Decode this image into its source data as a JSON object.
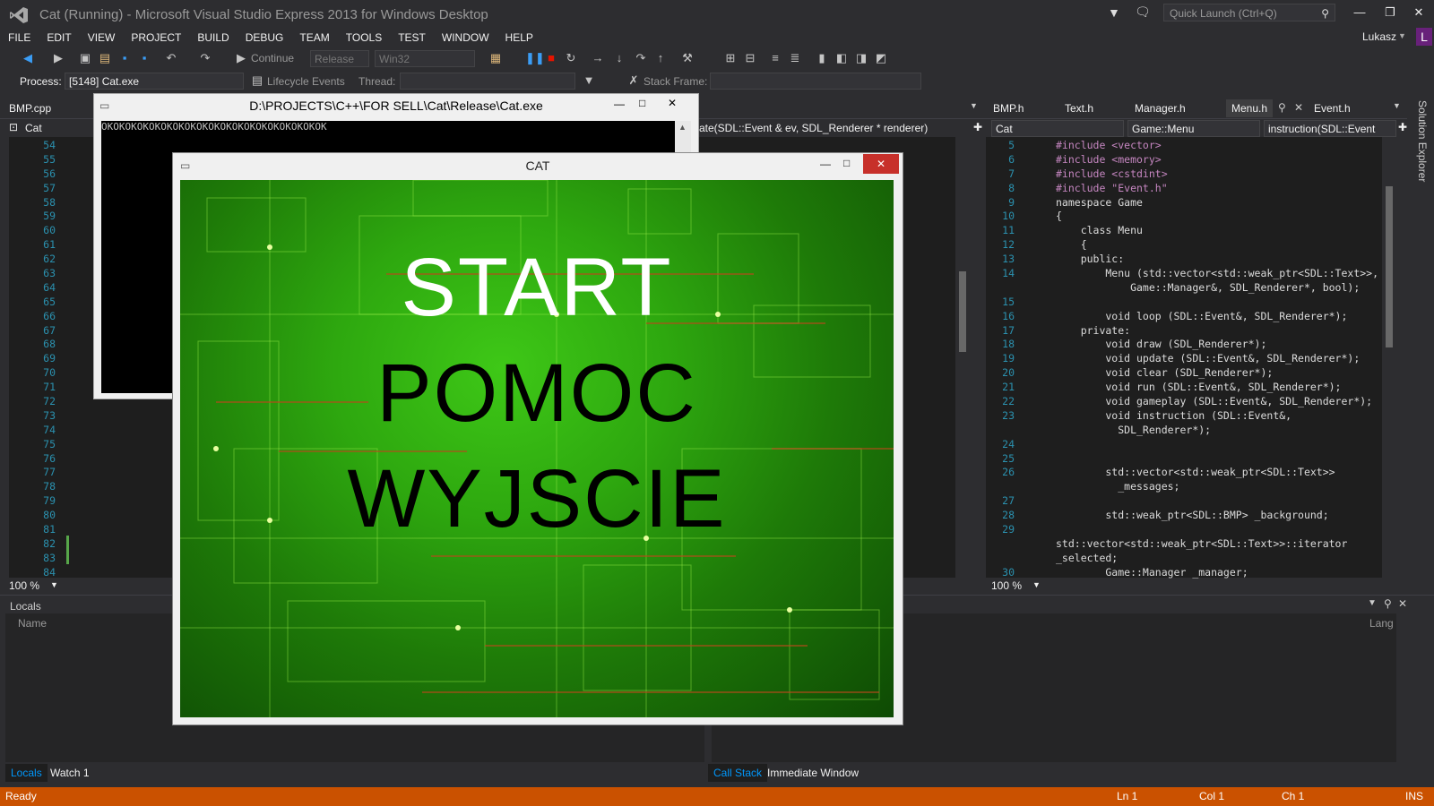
{
  "window": {
    "title": "Cat (Running) - Microsoft Visual Studio Express 2013 for Windows Desktop",
    "quick_launch_placeholder": "Quick Launch (Ctrl+Q)",
    "user": "Lukasz",
    "avatar_letter": "L"
  },
  "menu": [
    "FILE",
    "EDIT",
    "VIEW",
    "PROJECT",
    "BUILD",
    "DEBUG",
    "TEAM",
    "TOOLS",
    "TEST",
    "WINDOW",
    "HELP"
  ],
  "toolbar": {
    "continue_label": "Continue",
    "configuration": "Release",
    "platform": "Win32",
    "process_label": "Process:",
    "process_value": "[5148] Cat.exe",
    "lifecycle_label": "Lifecycle Events",
    "thread_label": "Thread:",
    "stack_frame_label": "Stack Frame:"
  },
  "left_editor": {
    "tab": "BMP.cpp",
    "nav_project": "Cat",
    "nav_func_fragment": "ate(SDL::Event & ev, SDL_Renderer * renderer)",
    "line_numbers": [
      "54",
      "55",
      "56",
      "57",
      "58",
      "59",
      "60",
      "61",
      "62",
      "63",
      "64",
      "65",
      "66",
      "67",
      "68",
      "69",
      "70",
      "71",
      "72",
      "73",
      "74",
      "75",
      "76",
      "77",
      "78",
      "79",
      "80",
      "81",
      "82",
      "83",
      "84"
    ],
    "zoom": "100 %"
  },
  "right_editor": {
    "tabs": [
      "BMP.h",
      "Text.h",
      "Manager.h",
      "Menu.h",
      "Event.h"
    ],
    "active_tab": "Menu.h",
    "nav_project": "Cat",
    "nav_class": "Game::Menu",
    "nav_member": "instruction(SDL::Event",
    "zoom": "100 %",
    "line_numbers": [
      "5",
      "6",
      "7",
      "8",
      "9",
      "10",
      "11",
      "12",
      "13",
      "14",
      "",
      "15",
      "16",
      "17",
      "18",
      "19",
      "20",
      "21",
      "22",
      "23",
      "",
      "24",
      "25",
      "26",
      "",
      "27",
      "28",
      "29",
      "",
      "",
      "30"
    ],
    "code_lines": [
      "#include <vector>",
      "#include <memory>",
      "#include <cstdint>",
      "#include \"Event.h\"",
      "namespace Game",
      "{",
      "    class Menu",
      "    {",
      "    public:",
      "        Menu (std::vector<std::weak_ptr<SDL::Text>>,",
      "            Game::Manager&, SDL_Renderer*, bool);",
      "",
      "        void loop (SDL::Event&, SDL_Renderer*);",
      "    private:",
      "        void draw (SDL_Renderer*);",
      "        void update (SDL::Event&, SDL_Renderer*);",
      "        void clear (SDL_Renderer*);",
      "        void run (SDL::Event&, SDL_Renderer*);",
      "        void gameplay (SDL::Event&, SDL_Renderer*);",
      "        void instruction (SDL::Event&,",
      "          SDL_Renderer*);",
      "",
      "",
      "        std::vector<std::weak_ptr<SDL::Text>>",
      "          _messages;",
      "",
      "        std::weak_ptr<SDL::BMP> _background;",
      "",
      "std::vector<std::weak_ptr<SDL::Text>>::iterator",
      "_selected;",
      "        Game::Manager _manager;"
    ]
  },
  "locals": {
    "title": "Locals",
    "col_name": "Name",
    "col_lang": "Lang",
    "tabs": [
      "Locals",
      "Watch 1"
    ]
  },
  "callstack": {
    "tabs": [
      "Call Stack",
      "Immediate Window"
    ]
  },
  "console": {
    "title": "D:\\PROJECTS\\C++\\FOR SELL\\Cat\\Release\\Cat.exe",
    "output": "OKOKOKOKOKOKOKOKOKOKOKOKOKOKOKOKOKOKOK"
  },
  "game": {
    "title": "CAT",
    "menu_items": [
      "START",
      "POMOC",
      "WYJSCIE"
    ]
  },
  "status": {
    "state": "Ready",
    "ln": "Ln 1",
    "col": "Col 1",
    "ch": "Ch 1",
    "mode": "INS"
  },
  "colors": {
    "accent": "#ca5100",
    "brand": "#68217a",
    "editor_bg": "#1e1e1e",
    "chrome_bg": "#2d2d30"
  }
}
